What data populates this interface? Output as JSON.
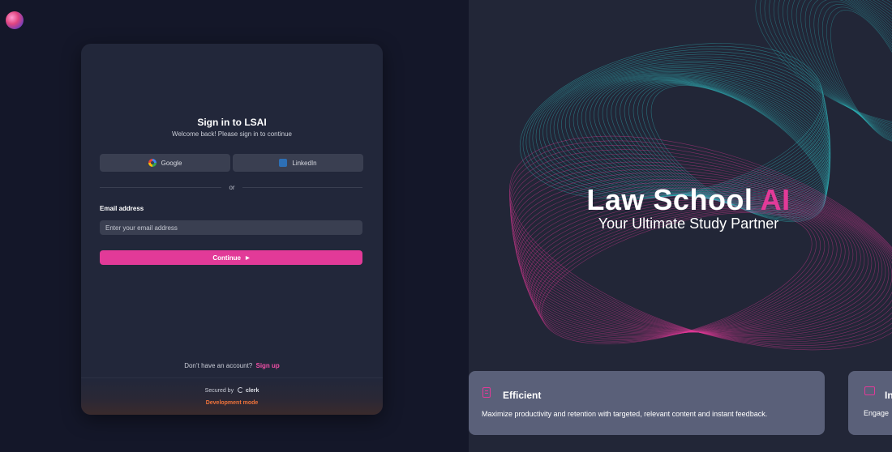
{
  "app": {
    "logo_name": "lsai-logo"
  },
  "signin": {
    "title": "Sign in to LSAI",
    "subtitle": "Welcome back! Please sign in to continue",
    "google_label": "Google",
    "linkedin_label": "LinkedIn",
    "or_label": "or",
    "email_label": "Email address",
    "email_placeholder": "Enter your email address",
    "email_value": "",
    "continue_label": "Continue",
    "no_account_text": "Don’t have an account?",
    "signup_label": "Sign up",
    "secured_by": "Secured by",
    "clerk_label": "clerk",
    "dev_mode": "Development mode"
  },
  "hero": {
    "title_main": "Law School ",
    "title_accent": "AI",
    "subtitle": "Your Ultimate Study Partner"
  },
  "features": [
    {
      "title": "Efficient",
      "description": "Maximize productivity and retention with targeted, relevant content and instant feedback.",
      "icon": "document-icon"
    },
    {
      "title": "In",
      "description": "Engage",
      "icon": "chat-icon"
    }
  ],
  "colors": {
    "accent": "#e23a98",
    "teal": "#2fb3b8",
    "dev_mode": "#f0733a"
  }
}
